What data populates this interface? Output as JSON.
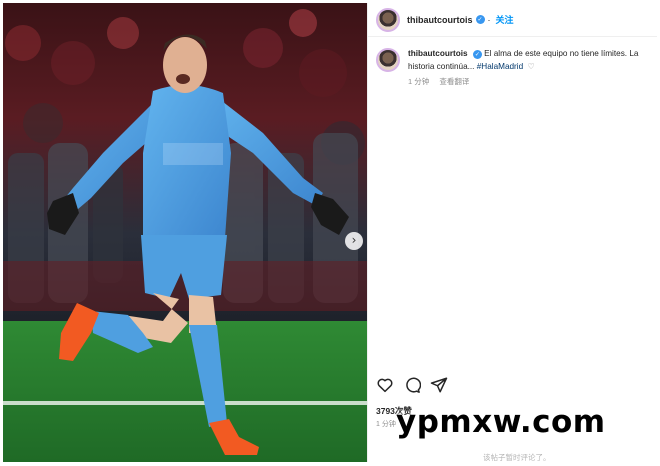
{
  "header": {
    "username": "thibautcourtois",
    "follow_label": "关注"
  },
  "caption": {
    "username": "thibautcourtois",
    "text": "El alma de este equipo no tiene límites. La historia continúa...",
    "hashtag": "#HalaMadrid",
    "time": "1 分钟",
    "translate_label": "查看翻译"
  },
  "footer": {
    "likes": "3793次赞",
    "time": "1 分钟",
    "comments_note": "该帖子暂时评论了。"
  },
  "carousel": {
    "next_icon": "chevron-right-icon"
  },
  "watermark": "ypmxw.com",
  "colors": {
    "link": "#0095f6",
    "jersey": "#4f9fe0",
    "pitch": "#2f8a34"
  }
}
